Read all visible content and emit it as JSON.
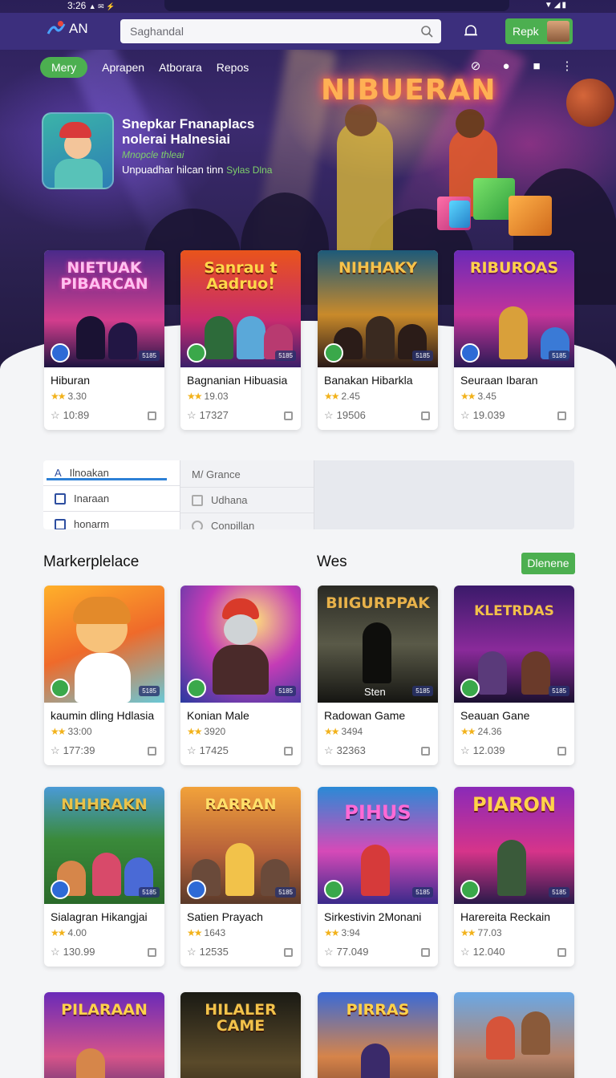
{
  "status": {
    "time": "3:26",
    "icons": "▲ ✉ ⚡"
  },
  "header": {
    "logo_text": "AN",
    "search_placeholder": "Saghandal",
    "account_button": "Repk"
  },
  "nav": {
    "active": "Mery",
    "links": [
      "Aprapen",
      "Atborara",
      "Repos"
    ]
  },
  "hero": {
    "marquee": "NIBUERAN",
    "title": "Snepkar Fnanaplacs nolerai Halnesiai",
    "subtitle": "Mnopcle thleai",
    "line": "Unpuadhar hilcan tinn",
    "line_tag": "Sylas Dlna"
  },
  "featured": [
    {
      "thumb_title": "NIETUAK PIBARCAN",
      "name": "Hiburan",
      "rating": "3.30",
      "likes": "10:89",
      "badge": "1",
      "count": "5185"
    },
    {
      "thumb_title": "Sanrau t Aadruo!",
      "name": "Bagnanian Hibuasia",
      "rating": "19.03",
      "likes": "17327",
      "badge": "2",
      "count": "5185"
    },
    {
      "thumb_title": "NIHHAKY",
      "name": "Banakan Hibarkla",
      "rating": "2.45",
      "likes": "19506",
      "badge": "2",
      "count": "5185"
    },
    {
      "thumb_title": "RIBUROAS",
      "name": "Seuraan Ibaran",
      "rating": "3.45",
      "likes": "19.039",
      "badge": "T",
      "count": "5185"
    }
  ],
  "filter": {
    "col1": [
      "Ilnoakan",
      "Inaraan",
      "honarm"
    ],
    "col2": [
      "M/ Grance",
      "Udhana",
      "Conpillan"
    ]
  },
  "marketplace": {
    "title": "Markerplelace",
    "tag": "Wes",
    "button": "Dlenene",
    "items": [
      {
        "thumb_title": "",
        "name": "kaumin dling Hdlasia",
        "rating": "33:00",
        "likes": "177:39"
      },
      {
        "thumb_title": "",
        "name": "Konian Male",
        "rating": "3920",
        "likes": "17425"
      },
      {
        "thumb_title": "BIIGURPPAK",
        "thumb_caption": "Sten",
        "name": "Radowan Game",
        "rating": "3494",
        "likes": "32363"
      },
      {
        "thumb_title": "KLETRDAS",
        "name": "Seauan Gane",
        "rating": "24.36",
        "likes": "12.039"
      },
      {
        "thumb_title": "NHHRAKN",
        "name": "Sialagran Hikangjai",
        "rating": "4.00",
        "likes": "130.99"
      },
      {
        "thumb_title": "RARRAN",
        "name": "Satien Prayach",
        "rating": "1643",
        "likes": "12535"
      },
      {
        "thumb_title": "PIHUS",
        "name": "Sirkestivin 2Monani",
        "rating": "3:94",
        "likes": "77.049"
      },
      {
        "thumb_title": "PIARON",
        "name": "Harereita Reckain",
        "rating": "77.03",
        "likes": "12.040"
      },
      {
        "thumb_title": "PILARAAN",
        "name": "",
        "rating": "",
        "likes": ""
      },
      {
        "thumb_title": "HILALER CAME",
        "name": "",
        "rating": "",
        "likes": ""
      },
      {
        "thumb_title": "PIRRAS",
        "name": "",
        "rating": "",
        "likes": ""
      },
      {
        "thumb_title": "",
        "name": "",
        "rating": "",
        "likes": ""
      }
    ]
  },
  "colors": {
    "accent": "#4caf50",
    "header": "#3c2f7d",
    "star": "#f2b21b"
  }
}
